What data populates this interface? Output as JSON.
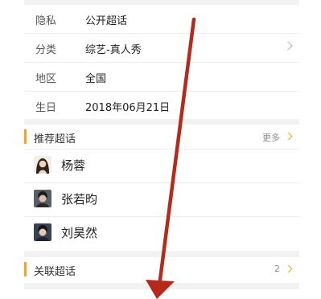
{
  "info": [
    {
      "label": "隐私",
      "value": "公开超话",
      "chevron": false
    },
    {
      "label": "分类",
      "value": "综艺-真人秀",
      "chevron": true
    },
    {
      "label": "地区",
      "value": "全国",
      "chevron": false
    },
    {
      "label": "生日",
      "value": "2018年06月21日",
      "chevron": false
    }
  ],
  "recommended": {
    "title": "推荐超话",
    "more_label": "更多",
    "people": [
      {
        "name": "杨蓉",
        "avatar_icon": "person-avatar-icon"
      },
      {
        "name": "张若昀",
        "avatar_icon": "person-avatar-icon"
      },
      {
        "name": "刘昊然",
        "avatar_icon": "person-avatar-icon"
      }
    ]
  },
  "related": {
    "title": "关联超话",
    "count": "2"
  },
  "colors": {
    "accent": "#f4a12a",
    "arrow": "#b52a1a"
  }
}
